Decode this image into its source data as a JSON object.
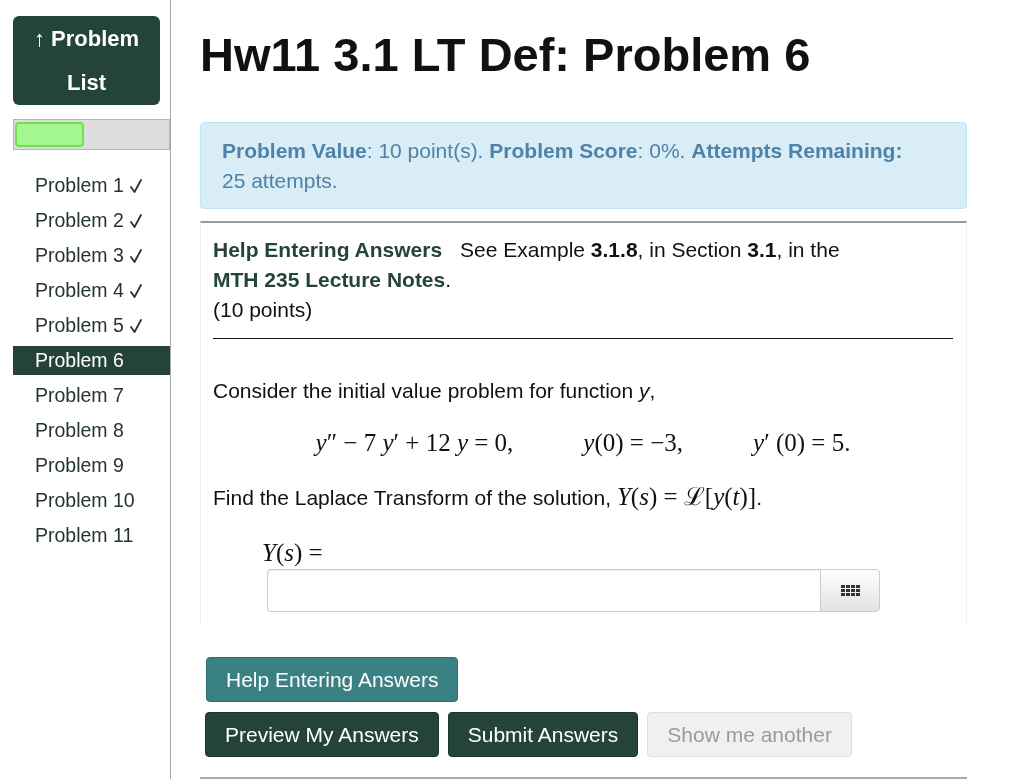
{
  "sidebar": {
    "problem_list_button": "↑ Problem List",
    "progress": {
      "level": 0.45
    },
    "problems": [
      {
        "label": "Problem 1",
        "completed": true,
        "selected": false
      },
      {
        "label": "Problem 2",
        "completed": true,
        "selected": false
      },
      {
        "label": "Problem 3",
        "completed": true,
        "selected": false
      },
      {
        "label": "Problem 4",
        "completed": true,
        "selected": false
      },
      {
        "label": "Problem 5",
        "completed": true,
        "selected": false
      },
      {
        "label": "Problem 6",
        "completed": false,
        "selected": true
      },
      {
        "label": "Problem 7",
        "completed": false,
        "selected": false
      },
      {
        "label": "Problem 8",
        "completed": false,
        "selected": false
      },
      {
        "label": "Problem 9",
        "completed": false,
        "selected": false
      },
      {
        "label": "Problem 10",
        "completed": false,
        "selected": false
      },
      {
        "label": "Problem 11",
        "completed": false,
        "selected": false
      }
    ]
  },
  "title": "Hw11 3.1 LT Def: Problem 6",
  "info": "**Problem Value**: 10 point(s). **Problem Score**: 0%. **Attempts Remaining:** 25 attempts.",
  "problem": {
    "help_link": "Help Entering Answers",
    "note": {
      "text": "See Example **3.1.8**, in Section **3.1**, in the ",
      "link": "MTH 235 Lecture Notes",
      "after": "."
    },
    "points": "(10 points)",
    "statement": "Consider the initial value problem for function *y*,",
    "equations": [
      "*y*″ − 7 *y*′ + 12 *y* = 0,",
      "*y*(0) = −3,",
      "*y*′ (0) = 5."
    ],
    "question": {
      "text": "Find the Laplace Transform of the solution, ",
      "math": "*Y*(*s*) = ℒ[*y*(*t*)]",
      "after": "."
    },
    "answer_label": "*Y*(*s*) ="
  },
  "help_button": "Help Entering Answers",
  "submit_buttons": [
    {
      "label": "Preview My Answers",
      "kind": "primary",
      "disabled": false
    },
    {
      "label": "Submit Answers",
      "kind": "primary",
      "disabled": false
    },
    {
      "label": "Show me another",
      "kind": "default",
      "disabled": true
    }
  ]
}
